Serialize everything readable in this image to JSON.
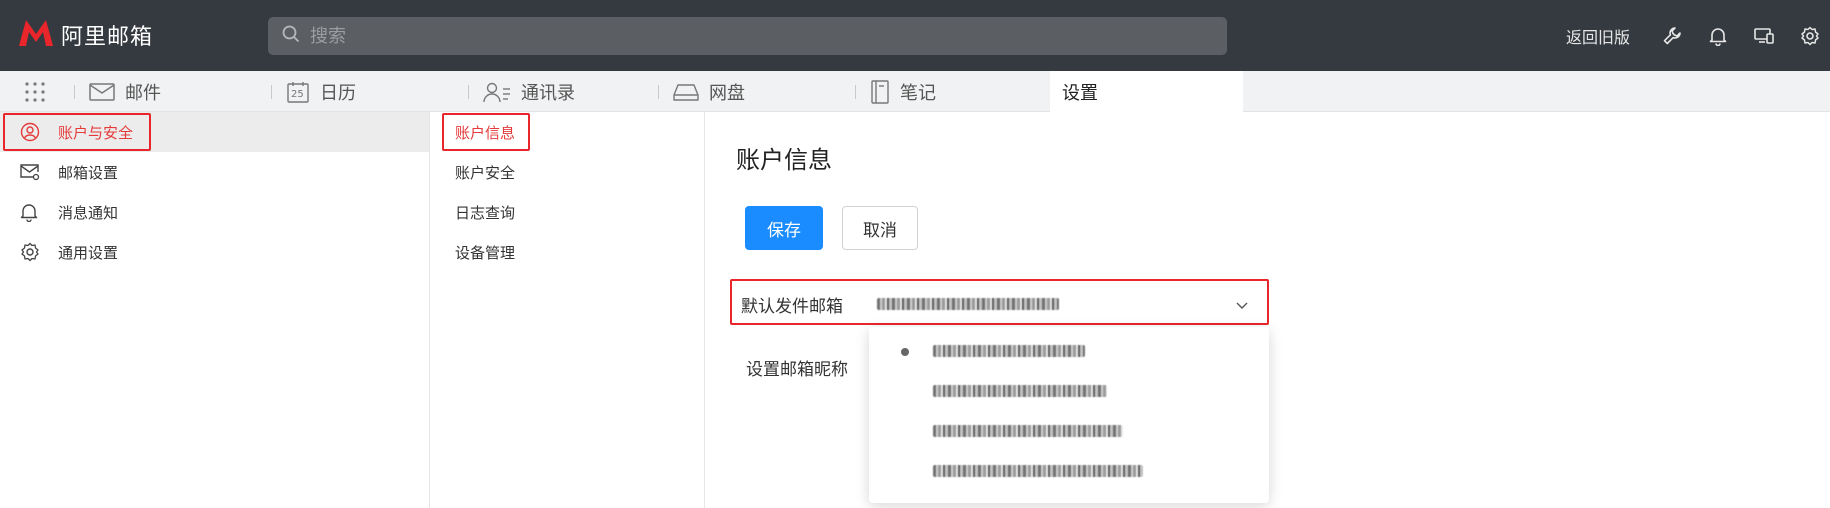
{
  "app": {
    "logo_text": "阿里邮箱",
    "logo_color": "#e8262b"
  },
  "search": {
    "placeholder": "搜索"
  },
  "topbar": {
    "old_version_label": "返回旧版",
    "icons": [
      "wrench-icon",
      "bell-icon",
      "devices-icon",
      "gear-icon"
    ]
  },
  "modules": [
    {
      "label": "邮件",
      "icon": "mail-icon"
    },
    {
      "label": "日历",
      "icon": "calendar-icon",
      "icon_text": "25"
    },
    {
      "label": "通讯录",
      "icon": "contacts-icon"
    },
    {
      "label": "网盘",
      "icon": "drive-icon"
    },
    {
      "label": "笔记",
      "icon": "notebook-icon"
    },
    {
      "label": "设置",
      "active": true
    }
  ],
  "sidebar": {
    "items": [
      {
        "label": "账户与安全",
        "icon": "user-circle-icon",
        "active": true
      },
      {
        "label": "邮箱设置",
        "icon": "mail-settings-icon"
      },
      {
        "label": "消息通知",
        "icon": "bell-icon"
      },
      {
        "label": "通用设置",
        "icon": "gear-icon"
      }
    ]
  },
  "subnav": {
    "items": [
      {
        "label": "账户信息",
        "active": true
      },
      {
        "label": "账户安全"
      },
      {
        "label": "日志查询"
      },
      {
        "label": "设备管理"
      }
    ]
  },
  "main": {
    "title": "账户信息",
    "save_label": "保存",
    "cancel_label": "取消",
    "default_sender_label": "默认发件邮箱",
    "nickname_label": "设置邮箱昵称"
  },
  "colors": {
    "accent": "#1a8cff",
    "active_red": "#e63a3a",
    "topbar_bg": "#353a40",
    "highlight_box": "#e8262b"
  }
}
